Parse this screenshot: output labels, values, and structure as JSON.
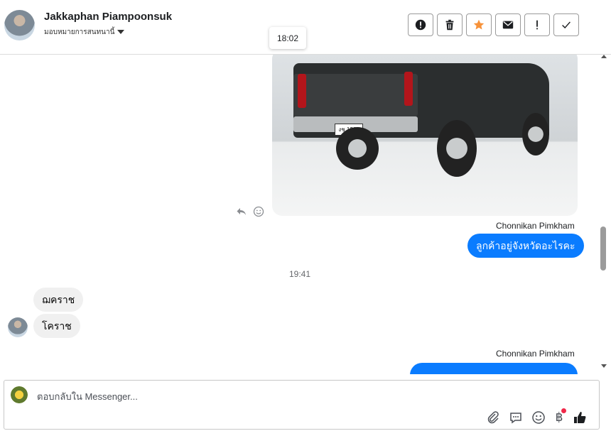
{
  "header": {
    "contact_name": "Jakkaphan Piampoonsuk",
    "assign_label": "มอบหมายการสนทนานี้",
    "actions": [
      {
        "icon": "alert-circle-icon"
      },
      {
        "icon": "trash-icon"
      },
      {
        "icon": "star-icon"
      },
      {
        "icon": "envelope-icon"
      },
      {
        "icon": "exclamation-icon"
      },
      {
        "icon": "check-icon"
      }
    ],
    "star_color": "#f7923a"
  },
  "tooltip": {
    "time": "18:02"
  },
  "thread": {
    "image_plate": "งช 1366",
    "messages": [
      {
        "sender": "Chonnikan Pimkham",
        "text": "ลูกค้าอยู่จังหวัดอะไรคะ"
      },
      {
        "time": "19:41"
      },
      {
        "text": "ฌคราช"
      },
      {
        "text": "โคราช"
      },
      {
        "sender": "Chonnikan Pimkham",
        "text": "..."
      }
    ],
    "outgoing_color": "#0a7cff"
  },
  "composer": {
    "placeholder": "ตอบกลับใน Messenger...",
    "currency_symbol": "฿",
    "tools": [
      "paperclip-icon",
      "message-bubble-icon",
      "emoji-icon",
      "baht-icon",
      "thumbs-up-icon"
    ]
  }
}
